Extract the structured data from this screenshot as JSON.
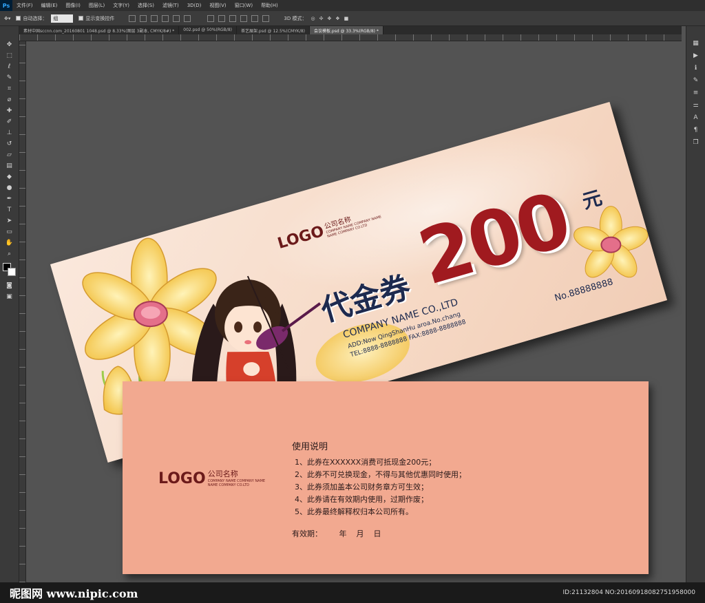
{
  "app": {
    "logo": "Ps"
  },
  "menu": [
    "文件(F)",
    "编辑(E)",
    "图像(I)",
    "图层(L)",
    "文字(Y)",
    "选择(S)",
    "滤镜(T)",
    "3D(D)",
    "视图(V)",
    "窗口(W)",
    "帮助(H)"
  ],
  "options": {
    "auto_select_label": "自动选择：",
    "auto_select_value": "组",
    "show_transform_label": "显示变换控件",
    "mode_3d_label": "3D 模式："
  },
  "tabs": [
    "素材中国sccnn.com_20160801 1048.psd @ 8.33%(图层 3副本, CMYK/8#) *",
    "002.psd @ 50%(RGB/8)",
    "茶艺展架.psd @ 12.5%(CMYK/8)",
    "会议模板.psd @ 33.3%(RGB/8) *"
  ],
  "ticket_front": {
    "logo": "LOGO",
    "company_cn": "公司名称",
    "company_en": "COMPANY NAME COMPANY NAME",
    "company_en2": "NAME COMPANY CO.LTD",
    "title": "代金券",
    "amount": "200",
    "unit": "元",
    "company_line": "COMPANY NAME CO.,LTD",
    "addr1": "ADD:Now QingShanHu aroa.No.chang",
    "addr2": "TEL:8888-8888888  FAX:8888-8888888",
    "serial": "No.88888888"
  },
  "ticket_back": {
    "logo": "LOGO",
    "company_cn": "公司名称",
    "company_en": "COMPANY NAME COMPANY NAME",
    "company_en2": "NAME COMPANY CO.LTD",
    "heading": "使用说明",
    "rules": [
      "1、此券在XXXXXX消费可抵现金200元；",
      "2、此券不可兑换现金，不得与其他优惠同时使用；",
      "3、此券须加盖本公司财务章方可生效；",
      "4、此券请在有效期内使用，过期作废；",
      "5、此券最终解释权归本公司所有。"
    ],
    "validity": "有效期：       年    月    日"
  },
  "watermark": {
    "site": "昵图网 www.nipic.com",
    "id": "ID:21132804 NO:20160918082751958000"
  },
  "colors": {
    "accent": "#a01a1f",
    "navy": "#1d2a4f",
    "back_bg": "#f2a990",
    "front_bg": "#f8dfcf"
  }
}
